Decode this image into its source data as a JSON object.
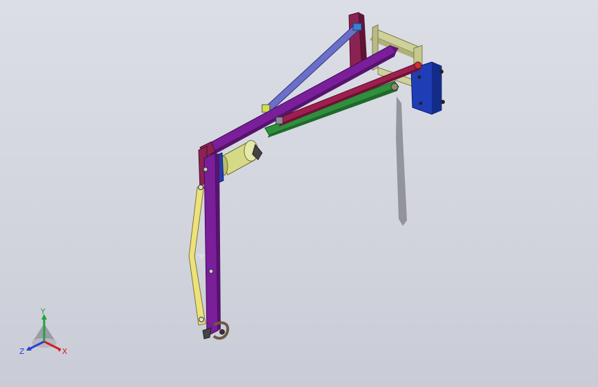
{
  "viewport": {
    "colors": {
      "rail": "#cfd19a",
      "wall_plate": "#1f3eb6",
      "boom": "#7a1e9a",
      "tie_rod": "#6b6fc9",
      "link": "#9e1f4f",
      "green_arm": "#2f8f3d",
      "motor": "#d5da86",
      "yellow_arm": "#ece27c",
      "bracket": "#8a2352"
    }
  },
  "triad": {
    "x_label": "X",
    "y_label": "Y",
    "z_label": "Z",
    "colors": {
      "x": "#d21e1e",
      "y": "#22a33a",
      "z": "#2a3fd0"
    }
  }
}
